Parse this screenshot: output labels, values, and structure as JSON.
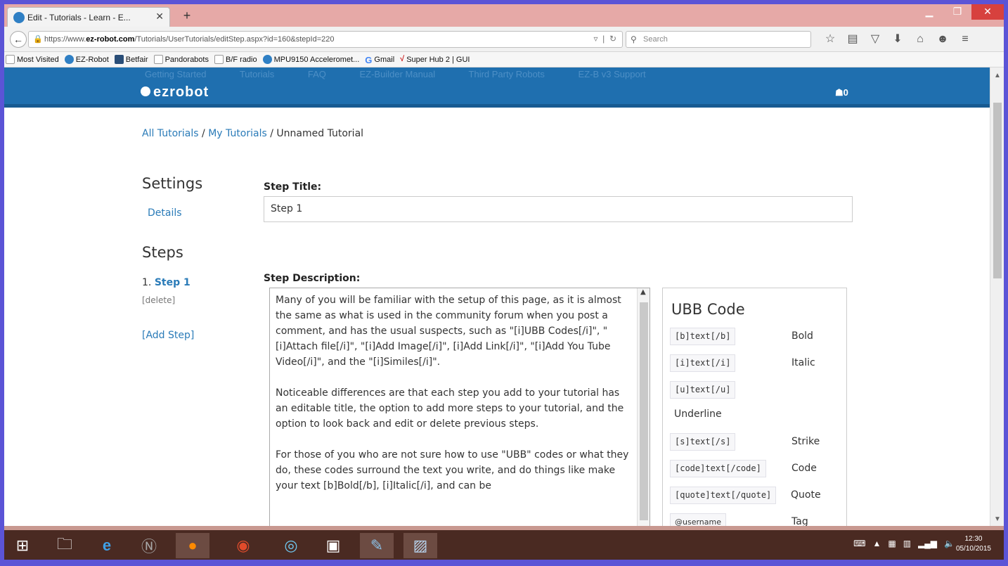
{
  "browser": {
    "tab_title": "Edit - Tutorials - Learn - E...",
    "new_tab": "+",
    "url_prefix": "https://www.",
    "url_domain": "ez-robot.com",
    "url_path": "/Tutorials/UserTutorials/editStep.aspx?id=160&stepId=220",
    "search_placeholder": "Search"
  },
  "bookmarks": [
    {
      "label": "Most Visited",
      "icon": "bookmark-star-icon"
    },
    {
      "label": "EZ-Robot",
      "icon": "ezrobot-icon"
    },
    {
      "label": "Betfair",
      "icon": "betfair-icon"
    },
    {
      "label": "Pandorabots",
      "icon": "folder-icon"
    },
    {
      "label": "B/F radio",
      "icon": "folder-icon"
    },
    {
      "label": "MPU9150 Acceleromet...",
      "icon": "ezrobot-icon"
    },
    {
      "label": "Gmail",
      "icon": "google-icon"
    },
    {
      "label": "Super Hub 2 | GUI",
      "icon": "check-icon"
    }
  ],
  "site": {
    "logo": "ezrobot",
    "cart_count": "0",
    "ghost_nav": [
      "Getting Started",
      "Tutorials",
      "FAQ",
      "EZ-Builder Manual",
      "Third Party Robots",
      "EZ-B v3 Support"
    ]
  },
  "breadcrumb": {
    "all": "All Tutorials",
    "sep1": " / ",
    "mine": "My Tutorials",
    "sep2": " / ",
    "current": "Unnamed Tutorial"
  },
  "sidebar": {
    "settings_heading": "Settings",
    "details_link": "Details",
    "steps_heading": "Steps",
    "step_number": "1.",
    "step_name": "Step 1",
    "delete_link": "[delete]",
    "add_step": "[Add Step]"
  },
  "form": {
    "step_title_label": "Step Title:",
    "step_title_value": "Step 1",
    "step_desc_label": "Step Description:",
    "paragraphs": [
      "Many of you will be familiar with the setup of this page, as it is almost the same as what is used in the community forum when you post a comment, and has the usual suspects, such as \"[i]UBB Codes[/i]\", \"[i]Attach file[/i]\", \"[i]Add Image[/i]\", [i]Add Link[/i]\", \"[i]Add You Tube Video[/i]\",  and the \"[i]Similes[/i]\".",
      "Noticeable differences are that each step you add to your tutorial has an editable title, the option to add more steps to your tutorial, and the option to look back and edit or delete previous steps.",
      "For those of you who are not sure how to use \"UBB\" codes or what they do, these codes surround the text you write, and do things like make your text [b]Bold[/b], [i]Italic[/i], and can be"
    ]
  },
  "ubb": {
    "title": "UBB Code",
    "codes": [
      {
        "code": "[b]text[/b]",
        "desc": "Bold"
      },
      {
        "code": "[i]text[/i]",
        "desc": "Italic"
      },
      {
        "code": "[u]text[/u]",
        "desc": "Underline"
      },
      {
        "code": "[s]text[/s]",
        "desc": "Strike"
      },
      {
        "code": "[code]text[/code]",
        "desc": "Code"
      },
      {
        "code": "[quote]text[/quote]",
        "desc": "Quote"
      },
      {
        "code": "@username",
        "desc": "Tag"
      }
    ]
  },
  "taskbar": {
    "clock_time": "12:30",
    "clock_date": "05/10/2015"
  },
  "colors": {
    "site_header": "#1f6faf",
    "link": "#2a7bb8",
    "taskbar": "#4a2a22"
  }
}
